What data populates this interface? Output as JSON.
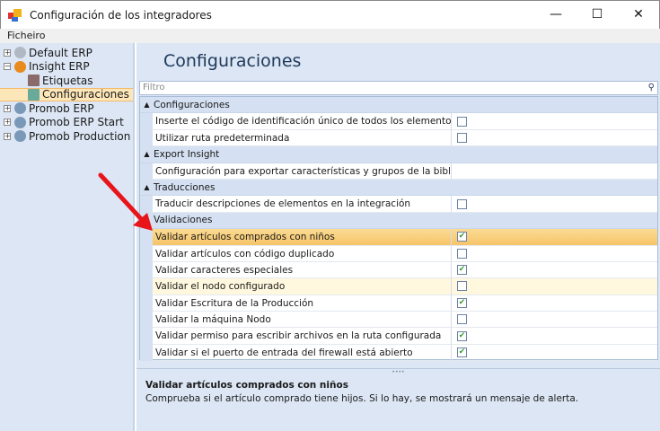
{
  "window": {
    "title": "Configuración de los integradores",
    "minimize": "—",
    "maximize": "☐",
    "close": "✕"
  },
  "menu": {
    "file": "Ficheiro"
  },
  "tree": [
    {
      "label": "Default ERP",
      "expander": "+",
      "color": "#b0b8c4"
    },
    {
      "label": "Insight ERP",
      "expander": "−",
      "color": "#e88a1c"
    },
    {
      "label": "Etiquetas",
      "child": true,
      "color": "#8a6a6a"
    },
    {
      "label": "Configuraciones",
      "child": true,
      "selected": true,
      "color": "#6aaa9a"
    },
    {
      "label": "Promob ERP",
      "expander": "+",
      "color": "#7a98b8"
    },
    {
      "label": "Promob ERP Start",
      "expander": "+",
      "color": "#7a98b8"
    },
    {
      "label": "Promob Production",
      "expander": "+",
      "color": "#7a98b8"
    }
  ],
  "main": {
    "heading": "Configuraciones",
    "filter_placeholder": "Filtro",
    "groups": [
      {
        "name": "Configuraciones",
        "rows": [
          {
            "label": "Inserte el código de identificación único de todos los elementos...",
            "type": "check",
            "checked": false
          },
          {
            "label": "Utilizar ruta predeterminada",
            "type": "check",
            "checked": false
          }
        ]
      },
      {
        "name": "Export Insight",
        "rows": [
          {
            "label": "Configuración para exportar características y grupos de la biblio...",
            "type": "text",
            "value": ""
          }
        ]
      },
      {
        "name": "Traducciones",
        "rows": [
          {
            "label": "Traducir descripciones de elementos en la integración",
            "type": "check",
            "checked": false
          }
        ]
      },
      {
        "name": "Validaciones",
        "rows": [
          {
            "label": "Validar artículos comprados con niños",
            "type": "check",
            "checked": true,
            "state": "selected"
          },
          {
            "label": "Validar artículos con código duplicado",
            "type": "check",
            "checked": false
          },
          {
            "label": "Validar caracteres especiales",
            "type": "check",
            "checked": true
          },
          {
            "label": "Validar el nodo configurado",
            "type": "check",
            "checked": false,
            "state": "hover"
          },
          {
            "label": "Validar Escritura de la Producción",
            "type": "check",
            "checked": true
          },
          {
            "label": "Validar la máquina Nodo",
            "type": "check",
            "checked": false
          },
          {
            "label": "Validar permiso para escribir archivos en la ruta configurada",
            "type": "check",
            "checked": true
          },
          {
            "label": "Validar si el puerto de entrada del firewall está abierto",
            "type": "check",
            "checked": true
          }
        ]
      }
    ],
    "description": {
      "title": "Validar artículos comprados con niños",
      "text": "Comprueba si el artículo comprado tiene hijos. Si lo hay, se mostrará un mensaje de alerta."
    }
  }
}
